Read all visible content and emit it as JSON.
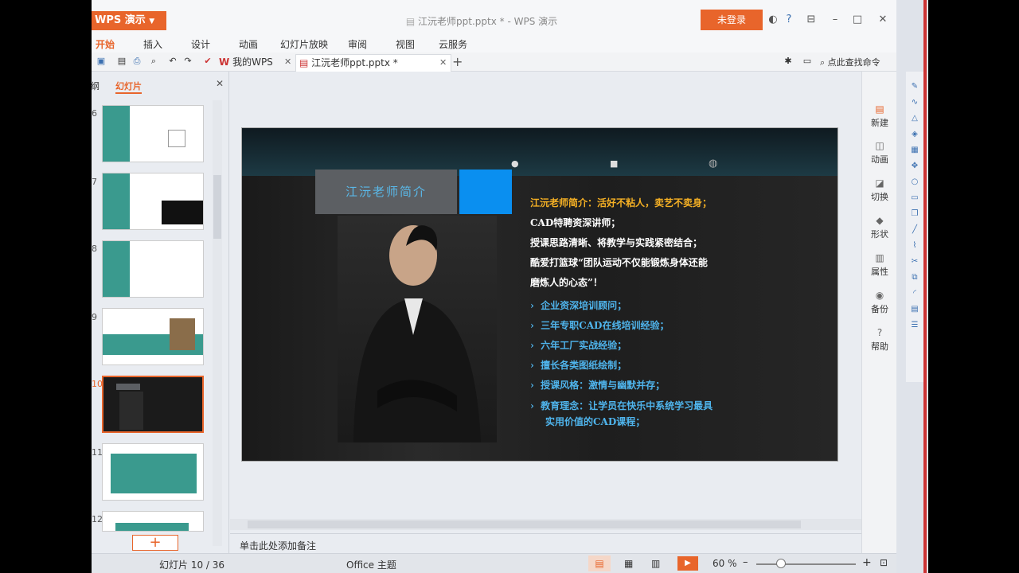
{
  "app": {
    "name": "WPS 演示",
    "doc_title": "江沅老师ppt.pptx * - WPS 演示",
    "login": "未登录"
  },
  "window": {
    "minimize": "–",
    "maximize": "□",
    "close": "✕"
  },
  "menu": [
    "开始",
    "插入",
    "设计",
    "动画",
    "幻灯片放映",
    "审阅",
    "视图",
    "云服务"
  ],
  "tabs": {
    "home": "我的WPS",
    "doc": "江沅老师ppt.pptx *",
    "add": "+"
  },
  "search_cmd": "点此查找命令",
  "left_panel": {
    "tab_outline": "大纲",
    "tab_slides": "幻灯片",
    "close": "✕",
    "numbers": [
      "6",
      "7",
      "8",
      "9",
      "10",
      "11",
      "12"
    ],
    "add": "+"
  },
  "slide": {
    "title": "江沅老师简介",
    "lines": [
      "江沅老师简介：活好不粘人，卖艺不卖身；",
      "CAD特聘资深讲师；",
      "授课思路清晰、将教学与实践紧密结合；",
      "酷爱打篮球“团队运动不仅能锻炼身体还能",
      "磨炼人的心态”！"
    ],
    "bullets": [
      "企业资深培训顾问；",
      "三年专职CAD在线培训经验；",
      "六年工厂实战经验；",
      "擅长各类图纸绘制；",
      "授课风格：激情与幽默并存；",
      "教育理念：让学员在快乐中系统学习最具"
    ],
    "bullet_cont": "实用价值的CAD课程；"
  },
  "dock": [
    "新建",
    "动画",
    "切换",
    "形状",
    "属性",
    "备份",
    "帮助"
  ],
  "notes": "单击此处添加备注",
  "status": {
    "slide_info": "幻灯片 10 / 36",
    "theme": "Office 主题",
    "zoom": "60 %",
    "zoom_value": 0.25,
    "minus": "–",
    "plus": "+"
  },
  "colors": {
    "accent": "#e8652b",
    "slide_title": "#5ab8e8",
    "slide_orange": "#f5b024",
    "slide_blue": "#4fb4ec"
  }
}
